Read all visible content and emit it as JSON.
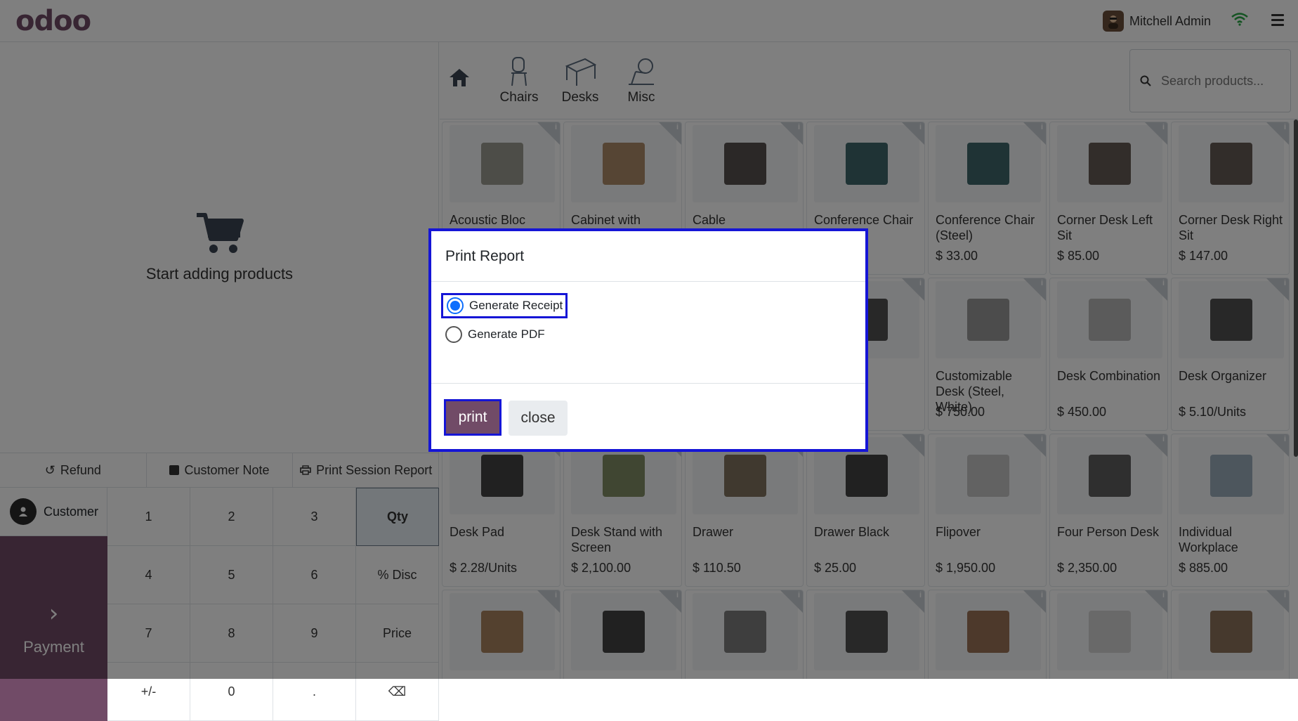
{
  "header": {
    "logo": "odoo",
    "user_name": "Mitchell Admin"
  },
  "left": {
    "empty_text": "Start adding products",
    "controls": [
      "Refund",
      "Customer Note",
      "Print Session Report"
    ],
    "customer_label": "Customer",
    "payment_label": "Payment",
    "numpad": [
      "1",
      "2",
      "3",
      "Qty",
      "4",
      "5",
      "6",
      "% Disc",
      "7",
      "8",
      "9",
      "Price",
      "+/-",
      "0",
      ".",
      "⌫"
    ]
  },
  "categories": [
    "Chairs",
    "Desks",
    "Misc"
  ],
  "search": {
    "placeholder": "Search products..."
  },
  "products": [
    {
      "name": "Acoustic Bloc",
      "price": ""
    },
    {
      "name": "Cabinet with",
      "price": ""
    },
    {
      "name": "Cable",
      "price": ""
    },
    {
      "name": "Conference Chair",
      "price": ""
    },
    {
      "name": "Conference Chair (Steel)",
      "price": "$ 33.00"
    },
    {
      "name": "Corner Desk Left Sit",
      "price": "$ 85.00"
    },
    {
      "name": "Corner Desk Right Sit",
      "price": "$ 147.00"
    },
    {
      "name": "",
      "price": ""
    },
    {
      "name": "",
      "price": ""
    },
    {
      "name": "",
      "price": ""
    },
    {
      "name": "",
      "price": ""
    },
    {
      "name": "Customizable Desk (Steel, White)",
      "price": "$ 750.00"
    },
    {
      "name": "Desk Combination",
      "price": "$ 450.00"
    },
    {
      "name": "Desk Organizer",
      "price": "$ 5.10/Units"
    },
    {
      "name": "Desk Pad",
      "price": "$ 2.28/Units"
    },
    {
      "name": "Desk Stand with Screen",
      "price": "$ 2,100.00"
    },
    {
      "name": "Drawer",
      "price": "$ 110.50"
    },
    {
      "name": "Drawer Black",
      "price": "$ 25.00"
    },
    {
      "name": "Flipover",
      "price": "$ 1,950.00"
    },
    {
      "name": "Four Person Desk",
      "price": "$ 2,350.00"
    },
    {
      "name": "Individual Workplace",
      "price": "$ 885.00"
    },
    {
      "name": "",
      "price": ""
    },
    {
      "name": "",
      "price": ""
    },
    {
      "name": "",
      "price": ""
    },
    {
      "name": "",
      "price": ""
    },
    {
      "name": "",
      "price": ""
    },
    {
      "name": "",
      "price": ""
    },
    {
      "name": "",
      "price": ""
    }
  ],
  "dialog": {
    "title": "Print Report",
    "options": [
      "Generate Receipt",
      "Generate PDF"
    ],
    "selected": "Generate Receipt",
    "print_label": "print",
    "close_label": "close"
  },
  "colors": {
    "brand": "#714B67",
    "highlight": "#1515d6",
    "radio": "#0d6efd"
  }
}
